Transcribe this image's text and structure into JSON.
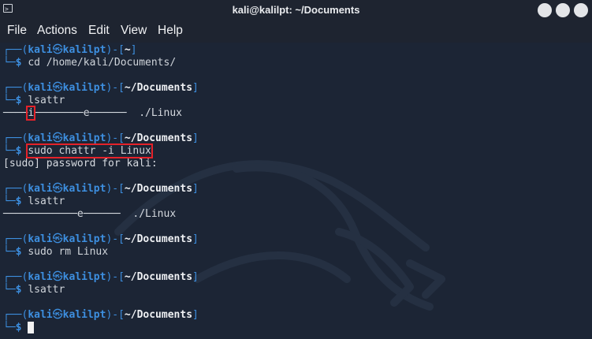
{
  "window": {
    "title": "kali@kalilpt: ~/Documents"
  },
  "menu": [
    "File",
    "Actions",
    "Edit",
    "View",
    "Help"
  ],
  "prompt": {
    "user": "kali",
    "at_symbol": "㉿",
    "host": "kalilpt",
    "dollar": "$"
  },
  "blocks": [
    {
      "dir": "~",
      "command": "cd /home/kali/Documents/"
    },
    {
      "dir": "~/Documents",
      "command": "lsattr",
      "output": {
        "attr_i": "i",
        "attr_rest": "-----------e--------",
        "file": "./Linux"
      }
    },
    {
      "dir": "~/Documents",
      "command": "sudo chattr -i Linux",
      "output_text": "[sudo] password for kali:"
    },
    {
      "dir": "~/Documents",
      "command": "lsattr",
      "output": {
        "attr_full": "----------------e--------",
        "file": "./Linux"
      }
    },
    {
      "dir": "~/Documents",
      "command": "sudo rm Linux"
    },
    {
      "dir": "~/Documents",
      "command": "lsattr"
    },
    {
      "dir": "~/Documents",
      "command": ""
    }
  ],
  "colors": {
    "prompt_blue": "#3d8fe0",
    "highlight_red": "#e5222a",
    "background": "#1c2535"
  }
}
